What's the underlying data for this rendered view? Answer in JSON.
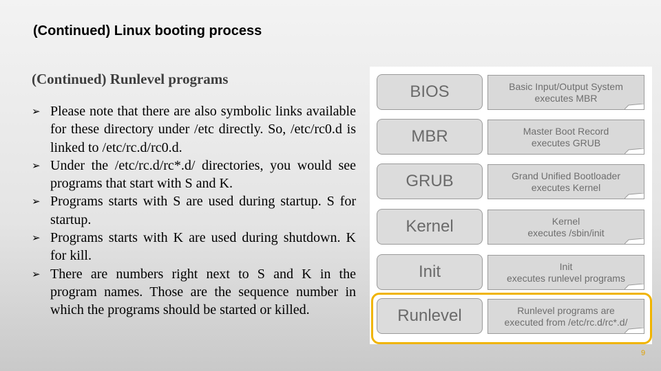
{
  "slide": {
    "title": "(Continued) Linux booting process",
    "subtitle": "(Continued) Runlevel programs",
    "bullet_icon": "arrowhead-bullet",
    "bullets": [
      "Please note that there are also symbolic links available for these directory under /etc directly. So, /etc/rc0.d is linked to /etc/rc.d/rc0.d.",
      "Under the /etc/rc.d/rc*.d/ directories, you would see programs that start with S and K.",
      "Programs starts with S are used during startup. S for startup.",
      "Programs starts with K are used during shutdown. K for kill.",
      "There are numbers right next to S and K in the program names. Those are the sequence number in which the programs should be started or killed."
    ],
    "page_number": "9"
  },
  "diagram": {
    "highlight_color": "#f0b400",
    "highlighted_stage": "Runlevel",
    "stages": [
      {
        "name": "BIOS",
        "line1": "Basic Input/Output System",
        "line2": "executes MBR"
      },
      {
        "name": "MBR",
        "line1": "Master Boot Record",
        "line2": "executes GRUB"
      },
      {
        "name": "GRUB",
        "line1": "Grand Unified Bootloader",
        "line2": "executes Kernel"
      },
      {
        "name": "Kernel",
        "line1": "Kernel",
        "line2": "executes /sbin/init"
      },
      {
        "name": "Init",
        "line1": "Init",
        "line2": "executes runlevel programs"
      },
      {
        "name": "Runlevel",
        "line1": "Runlevel programs are",
        "line2": "executed from /etc/rc.d/rc*.d/"
      }
    ]
  }
}
